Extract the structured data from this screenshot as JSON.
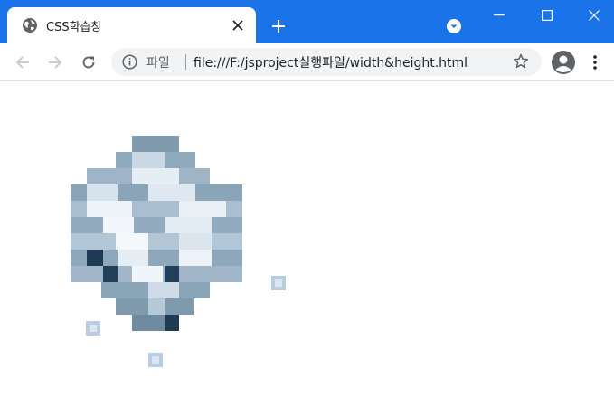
{
  "tab": {
    "title": "CSS학습창",
    "icon": "globe-icon"
  },
  "address": {
    "scheme_label": "파일",
    "url": "file:///F:/jsproject실행파일/width&height.html"
  },
  "colors": {
    "titlebar": "#1a73e8",
    "tab": "#ffffff",
    "omnibox": "#f1f3f4"
  },
  "content": {
    "image": "pixel-art-ore-sprite"
  }
}
